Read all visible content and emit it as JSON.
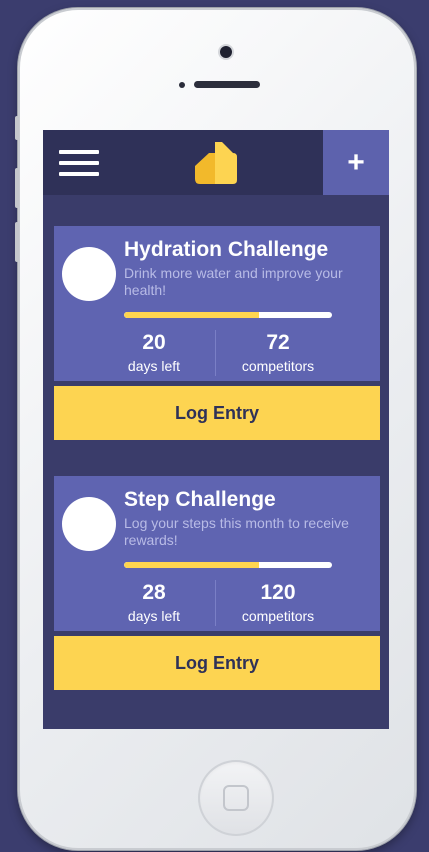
{
  "colors": {
    "background": "#3b3d6e",
    "topbar": "#2f3158",
    "accent_purple": "#5d62ad",
    "card": "#5f64b1",
    "accent_yellow": "#fdd451",
    "progress_fill": "#ffd54f"
  },
  "topbar": {
    "menu_icon": "hamburger-icon",
    "logo_icon": "app-logo",
    "add_label": "+"
  },
  "challenges": [
    {
      "title": "Hydration Challenge",
      "description": "Drink more water and improve your health!",
      "progress": 0.65,
      "days": "20",
      "days_label": "days left",
      "competitors": "72",
      "competitors_label": "competitors",
      "button_label": "Log Entry"
    },
    {
      "title": "Step Challenge",
      "description": "Log your steps this month to receive rewards!",
      "progress": 0.65,
      "days": "28",
      "days_label": "days left",
      "competitors": "120",
      "competitors_label": "competitors",
      "button_label": "Log Entry"
    }
  ]
}
